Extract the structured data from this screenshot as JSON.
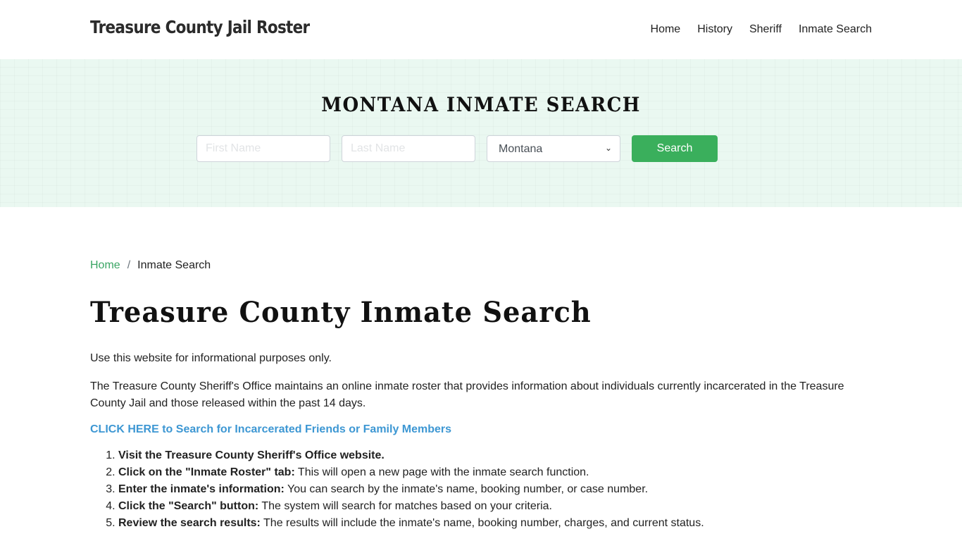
{
  "header": {
    "brand": "Treasure County Jail Roster",
    "nav": [
      {
        "label": "Home"
      },
      {
        "label": "History"
      },
      {
        "label": "Sheriff"
      },
      {
        "label": "Inmate Search"
      }
    ]
  },
  "hero": {
    "title": "MONTANA INMATE SEARCH",
    "first_name_placeholder": "First Name",
    "first_name_value": "",
    "last_name_placeholder": "Last Name",
    "last_name_value": "",
    "state_selected": "Montana",
    "search_label": "Search",
    "accent_color": "#3aaf5c"
  },
  "breadcrumb": {
    "home": "Home",
    "separator": "/",
    "current": "Inmate Search"
  },
  "main": {
    "title": "Treasure County Inmate Search",
    "intro": "Use this website for informational purposes only.",
    "description": "The Treasure County Sheriff's Office maintains an online inmate roster that provides information about individuals currently incarcerated in the Treasure County Jail and those released within the past 14 days.",
    "cta_link": "CLICK HERE to Search for Incarcerated Friends or Family Members",
    "steps": [
      {
        "bold": "Visit the Treasure County Sheriff's Office website.",
        "text": ""
      },
      {
        "bold": "Click on the \"Inmate Roster\" tab:",
        "text": " This will open a new page with the inmate search function."
      },
      {
        "bold": "Enter the inmate's information:",
        "text": " You can search by the inmate's name, booking number, or case number."
      },
      {
        "bold": "Click the \"Search\" button:",
        "text": " The system will search for matches based on your criteria."
      },
      {
        "bold": "Review the search results:",
        "text": " The results will include the inmate's name, booking number, charges, and current status."
      }
    ]
  }
}
